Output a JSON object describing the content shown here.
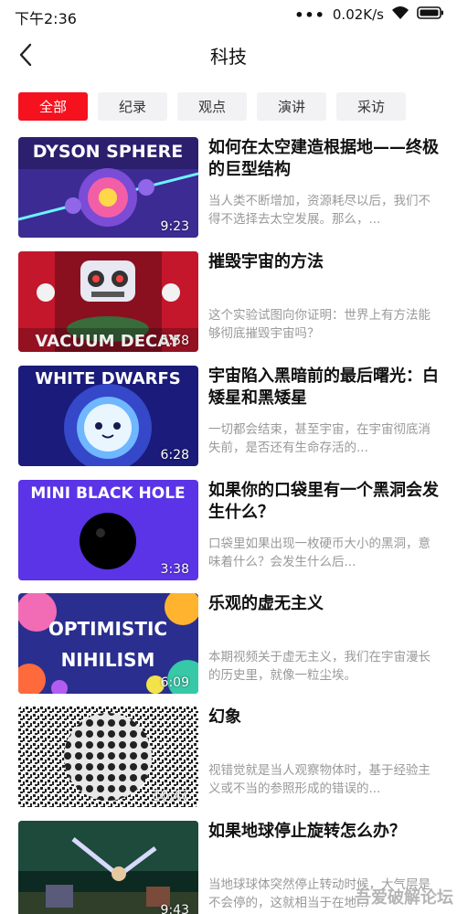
{
  "status_bar": {
    "time": "下午2:36",
    "network_speed": "0.02K/s",
    "icons": [
      "more-dots-icon",
      "wifi-icon",
      "battery-icon"
    ]
  },
  "header": {
    "title": "科技",
    "back_icon": "chevron-left-icon"
  },
  "tabs": [
    {
      "label": "全部",
      "active": true
    },
    {
      "label": "纪录",
      "active": false
    },
    {
      "label": "观点",
      "active": false
    },
    {
      "label": "演讲",
      "active": false
    },
    {
      "label": "采访",
      "active": false
    }
  ],
  "videos": [
    {
      "thumb_text": "DYSON SPHERE",
      "duration": "9:23",
      "title": "如何在太空建造根据地——终极的巨型结构",
      "desc": "当人类不断增加，资源耗尽以后，我们不得不选择去太空发展。那么，..."
    },
    {
      "thumb_text": "VACUUM DECAY",
      "duration": "5:58",
      "title": "摧毁宇宙的方法",
      "desc": "这个实验试图向你证明：世界上有方法能够彻底摧毁宇宙吗？"
    },
    {
      "thumb_text": "WHITE DWARFS",
      "duration": "6:28",
      "title": "宇宙陷入黑暗前的最后曙光：白矮星和黑矮星",
      "desc": "一切都会结束，甚至宇宙，在宇宙彻底消失前，是否还有生命存活的..."
    },
    {
      "thumb_text": "MINI BLACK HOLE",
      "duration": "3:38",
      "title": "如果你的口袋里有一个黑洞会发生什么？",
      "desc": "口袋里如果出现一枚硬币大小的黑洞，意味着什么？会发生什么后..."
    },
    {
      "thumb_text_1": "OPTIMISTIC",
      "thumb_text_2": "NIHILISM",
      "duration": "6:09",
      "title": "乐观的虚无主义",
      "desc": "本期视频关于虚无主义，我们在宇宙漫长的历史里，就像一粒尘埃。"
    },
    {
      "duration": "10:47",
      "title": "幻象",
      "desc": "视错觉就是当人观察物体时，基于经验主义或不当的参照形成的错误的..."
    },
    {
      "duration": "9:43",
      "title": "如果地球停止旋转怎么办？",
      "desc": "当地球球体突然停止转动时候，大气层是不会停的，这就相当于在地..."
    }
  ],
  "watermark": "吾爱破解论坛",
  "colors": {
    "accent": "#f5121e",
    "tab_bg": "#f2f2f4",
    "desc": "#999999"
  }
}
